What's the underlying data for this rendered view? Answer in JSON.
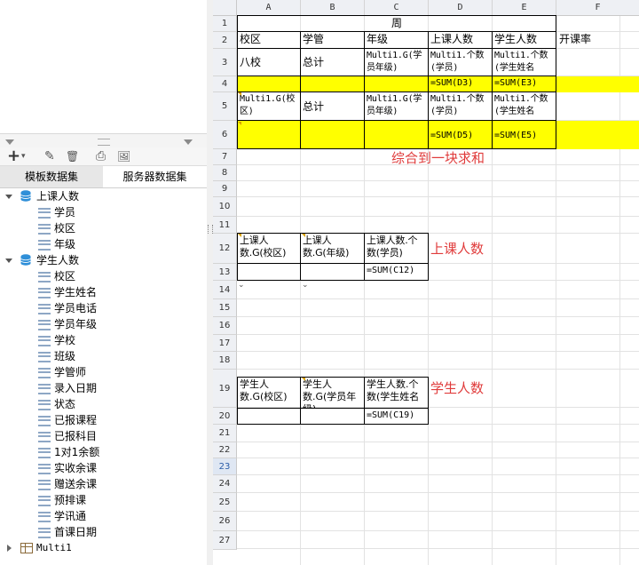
{
  "left_panel": {
    "toolbar": {
      "add": "+",
      "add_caret": "▾",
      "edit": "✎",
      "delete": "🗑",
      "preview": "⎙",
      "image": "🖼"
    },
    "tabs": [
      "模板数据集",
      "服务器数据集"
    ],
    "tree": [
      {
        "label": "上课人数",
        "icon": "database-icon",
        "expanded": true,
        "fields": [
          "学员",
          "校区",
          "年级"
        ]
      },
      {
        "label": "学生人数",
        "icon": "database-icon",
        "expanded": true,
        "fields": [
          "校区",
          "学生姓名",
          "学员电话",
          "学员年级",
          "学校",
          "班级",
          "学管师",
          "录入日期",
          "状态",
          "已报课程",
          "已报科目",
          "1对1余额",
          "实收余课",
          "赠送余课",
          "预排课",
          "学讯通",
          "首课日期"
        ]
      },
      {
        "label": "Multi1",
        "icon": "table-icon",
        "expanded": false,
        "fields": []
      }
    ]
  },
  "sheet": {
    "columns": [
      "A",
      "B",
      "C",
      "D",
      "E",
      "F"
    ],
    "rows": [
      "1",
      "2",
      "3",
      "4",
      "5",
      "6",
      "7",
      "8",
      "9",
      "10",
      "11",
      "12",
      "13",
      "14",
      "15",
      "16",
      "17",
      "18",
      "19",
      "20",
      "21",
      "22",
      "23",
      "24",
      "25",
      "26",
      "27"
    ],
    "selected_row": "23",
    "cells": {
      "r1_merged": "周",
      "A2": "校区",
      "B2": "学管",
      "C2": "年级",
      "D2": "上课人数",
      "E2": "学生人数",
      "F2": "开课率",
      "A3": "八校",
      "B3": "总计",
      "C3": "Multi1.G(学员年级)",
      "D3": "Multi1.个数(学员)",
      "E3": "Multi1.个数(学生姓名",
      "D4": "=SUM(D3)",
      "E4": "=SUM(E3)",
      "A5": "Multi1.G(校区)",
      "B5": "总计",
      "C5": "Multi1.G(学员年级)",
      "D5": "Multi1.个数(学员)",
      "E5": "Multi1.个数(学生姓名",
      "D6": "=SUM(D5)",
      "E6": "=SUM(E5)",
      "A12": "上课人数.G(校区)",
      "B12": "上课人数.G(年级)",
      "C12": "上课人数.个数(学员)",
      "C13": "=SUM(C12)",
      "A19": "学生人数.G(校区)",
      "B19": "学生人数.G(学员年级)",
      "C19": "学生人数.个数(学生姓名",
      "C20": "=SUM(C19)"
    },
    "annotations": {
      "row7": "综合到一块求和",
      "row12": "上课人数",
      "row19": "学生人数"
    },
    "colors": {
      "highlight": "#ffff00",
      "annotation": "#e03c3c",
      "db_icon": "#2f8fd8"
    }
  }
}
